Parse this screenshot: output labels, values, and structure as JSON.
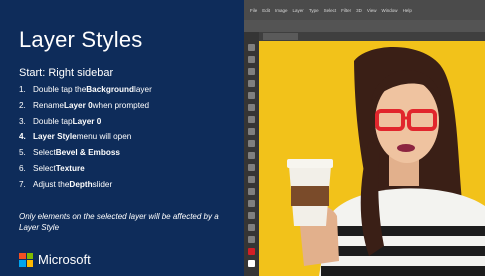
{
  "slide": {
    "title": "Layer Styles",
    "start": "Start: Right sidebar",
    "steps": [
      {
        "num": "1.",
        "parts": [
          "Double tap the ",
          "Background",
          " layer"
        ]
      },
      {
        "num": "2.",
        "parts": [
          "Rename ",
          "Layer 0",
          " when prompted"
        ]
      },
      {
        "num": "3.",
        "parts": [
          "Double tap ",
          "Layer 0",
          ""
        ]
      },
      {
        "num": "4.",
        "parts": [
          "",
          "Layer Style",
          " menu will open"
        ]
      },
      {
        "num": "5.",
        "parts": [
          "Select ",
          "Bevel & Emboss",
          ""
        ]
      },
      {
        "num": "6.",
        "parts": [
          "Select ",
          "Texture",
          ""
        ]
      },
      {
        "num": "7.",
        "parts": [
          "Adjust the ",
          "Depth",
          " slider"
        ]
      }
    ],
    "note": "Only elements on the selected layer will be affected by a Layer Style",
    "brand": "Microsoft"
  },
  "colors": {
    "panel_bg": "#0e2c5a",
    "canvas_bg": "#f2c21a",
    "glasses": "#e1262d",
    "ms_red": "#f25022",
    "ms_green": "#7fba00",
    "ms_blue": "#00a4ef",
    "ms_yellow": "#ffb900"
  },
  "photoshop": {
    "menu": [
      "File",
      "Edit",
      "Image",
      "Layer",
      "Type",
      "Select",
      "Filter",
      "3D",
      "View",
      "Window",
      "Help"
    ]
  }
}
